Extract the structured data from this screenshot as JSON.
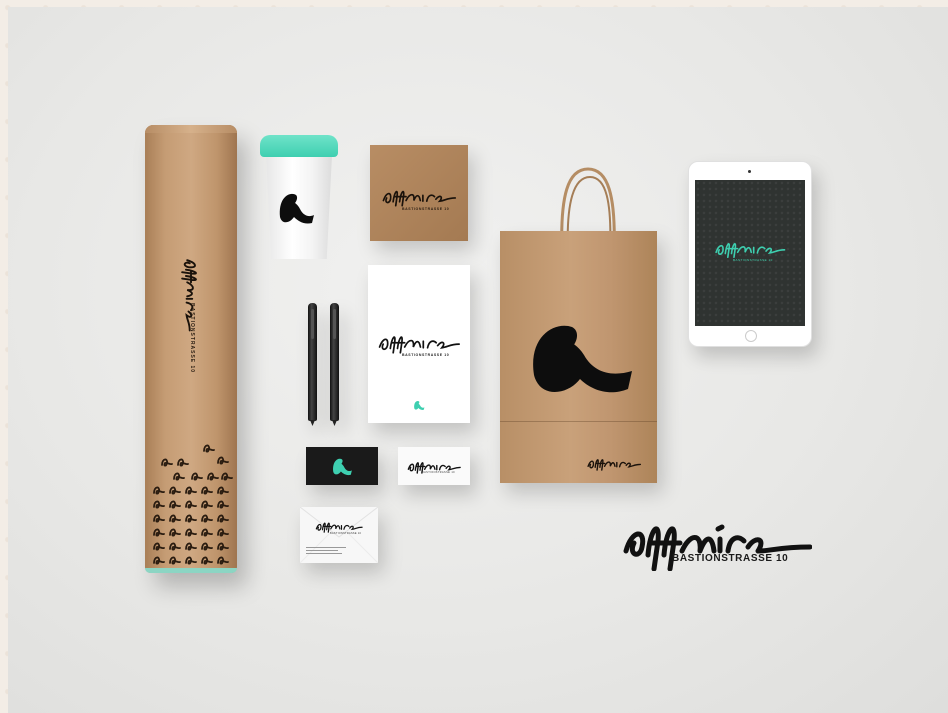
{
  "scene": {
    "description_icon": "branding-mockup",
    "brand": {
      "wordmark": "affaire",
      "address": "BASTIONSTRASSE 10"
    },
    "colors": {
      "accent": "#3ecfb0",
      "kraft": "#c59c74",
      "ink": "#111111"
    }
  }
}
